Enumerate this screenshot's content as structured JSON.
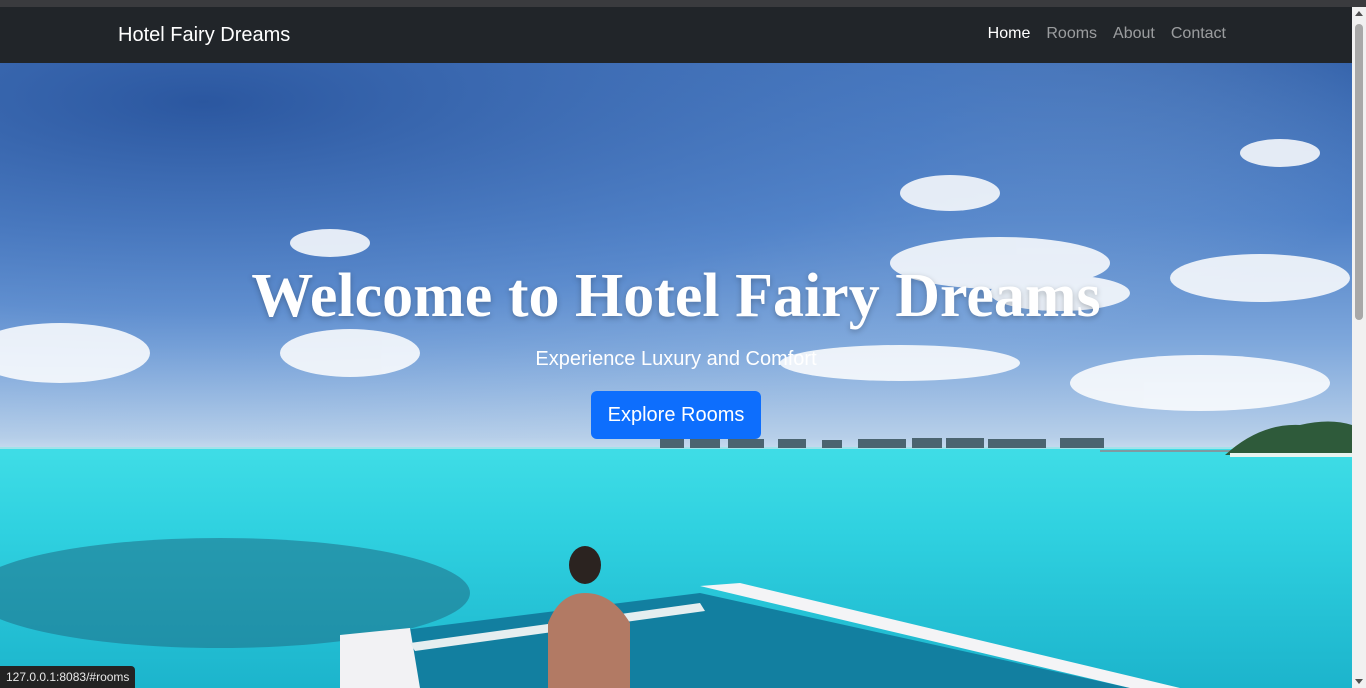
{
  "navbar": {
    "brand": "Hotel Fairy Dreams",
    "links": [
      {
        "label": "Home",
        "active": true
      },
      {
        "label": "Rooms",
        "active": false
      },
      {
        "label": "About",
        "active": false
      },
      {
        "label": "Contact",
        "active": false
      }
    ]
  },
  "hero": {
    "title": "Welcome to Hotel Fairy Dreams",
    "subtitle": "Experience Luxury and Comfort",
    "cta_label": "Explore Rooms",
    "image_icon": "tropical-ocean-villa-photo"
  },
  "status_bar": {
    "url": "127.0.0.1:8083/#rooms"
  },
  "colors": {
    "navbar_bg": "#212529",
    "primary_button": "#0d6efd",
    "sea": "#2fd1e0",
    "sky": "#4d7fc6"
  }
}
